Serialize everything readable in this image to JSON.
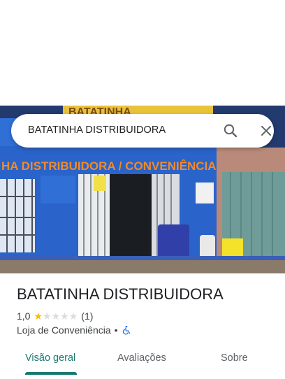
{
  "search": {
    "query": "BATATINHA DISTRIBUIDORA",
    "icons": [
      "search-icon",
      "close-icon"
    ]
  },
  "place": {
    "name": "BATATINHA DISTRIBUIDORA",
    "rating": "1,0",
    "rating_value": 1,
    "rating_max": 5,
    "review_count": "(1)",
    "category": "Loja de Conveniência",
    "separator": "•",
    "accessibility_icon": "wheelchair-icon"
  },
  "photo": {
    "sign_text": "HA DISTRIBUIDORA / CONVENIÊNCIA",
    "top_sign_text": "BATATINHA"
  },
  "tabs": [
    {
      "label": "Visão geral",
      "active": true
    },
    {
      "label": "Avaliações",
      "active": false
    },
    {
      "label": "Sobre",
      "active": false
    }
  ],
  "colors": {
    "accent": "#1a7a72",
    "star": "#fbbc04",
    "facade_blue": "#1c4fa6"
  }
}
